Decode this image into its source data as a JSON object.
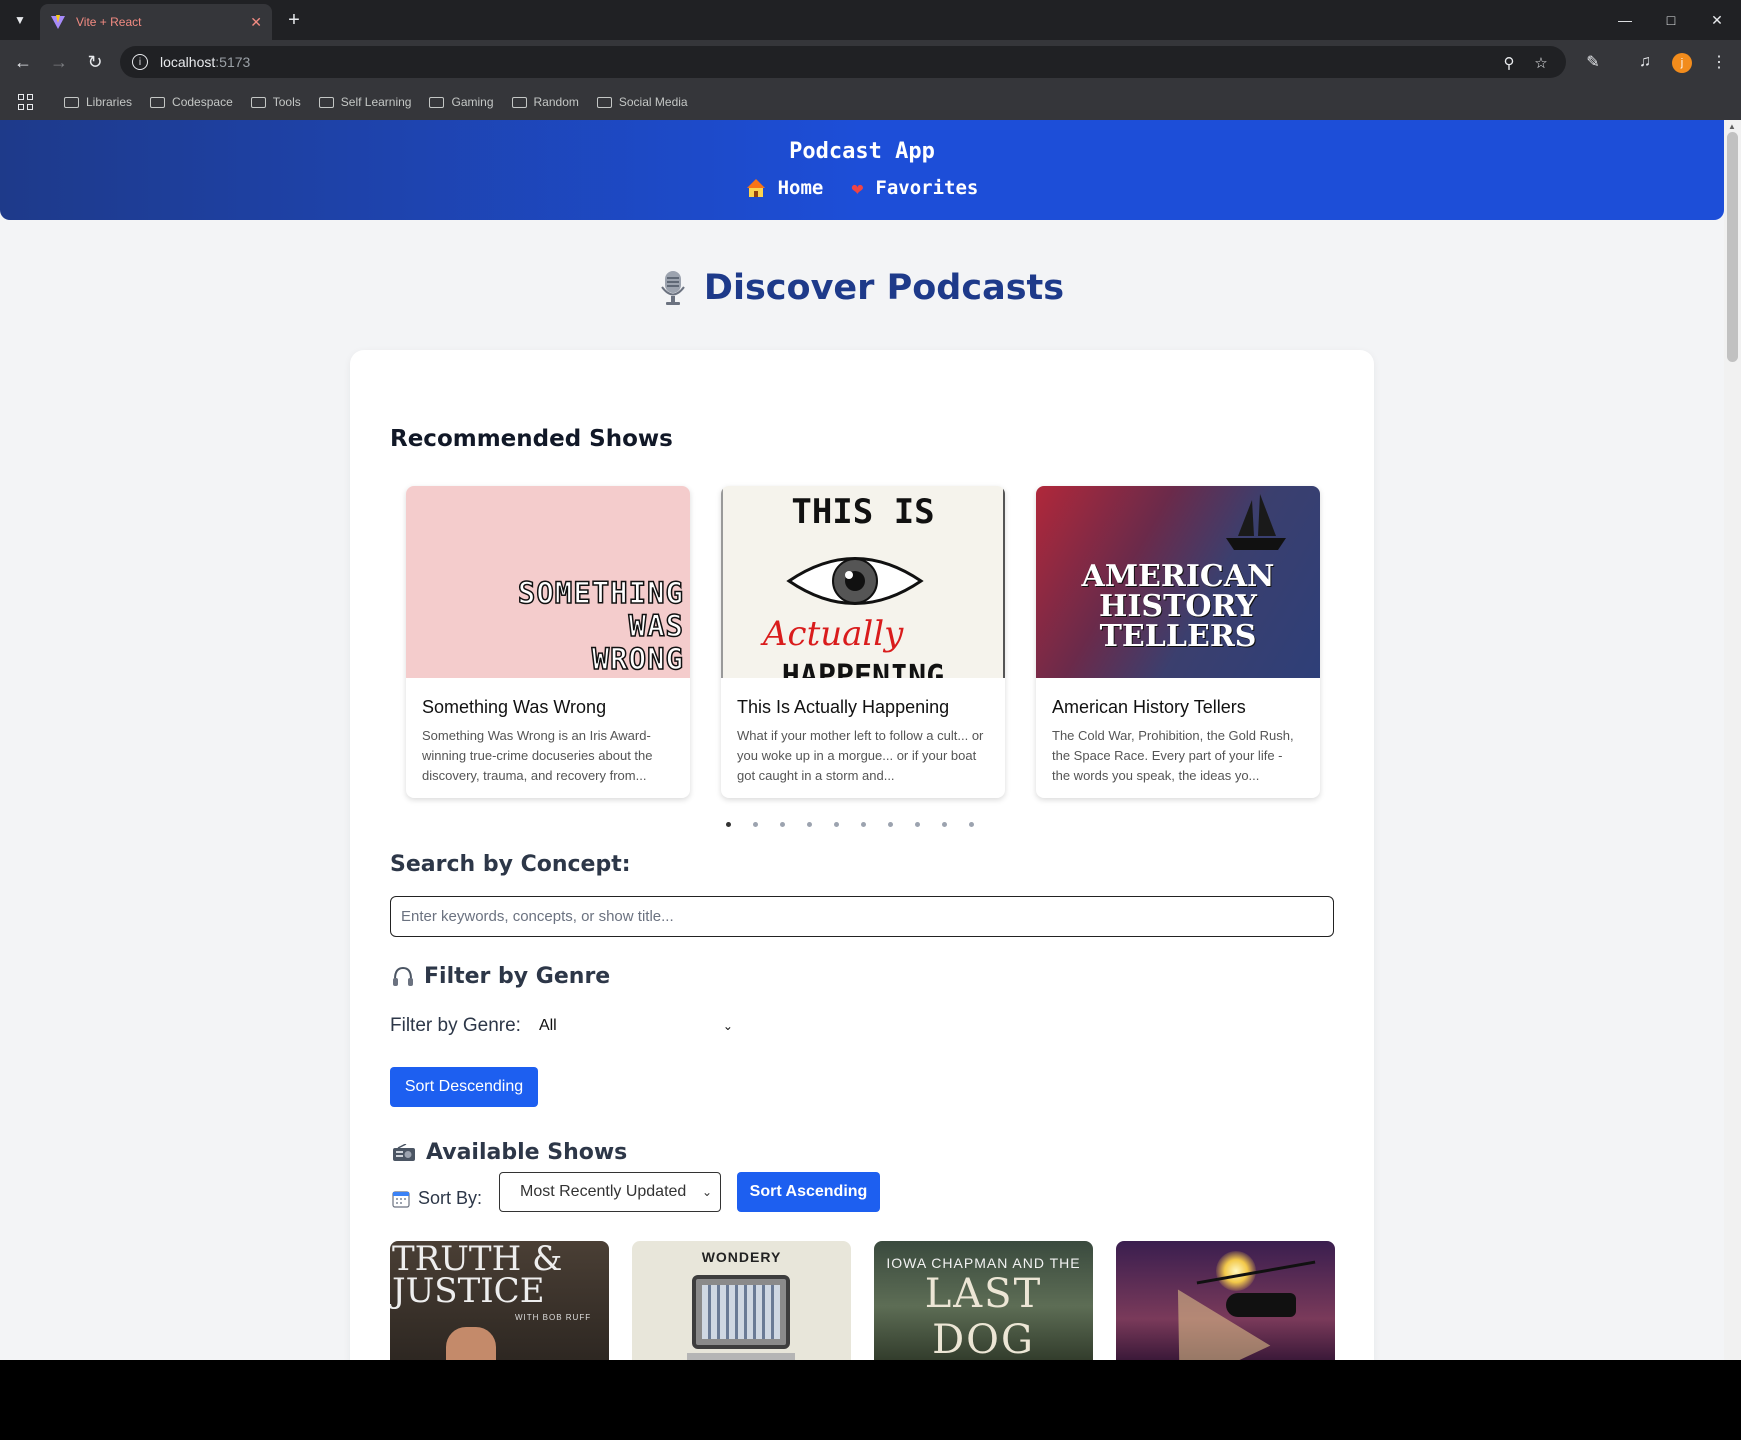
{
  "browser": {
    "tab_title": "Vite + React",
    "tab_close": "✕",
    "new_tab": "+",
    "url_host": "localhost",
    "url_port": ":5173",
    "bookmarks": [
      "Libraries",
      "Codespace",
      "Tools",
      "Self Learning",
      "Gaming",
      "Random",
      "Social Media"
    ],
    "avatar_letter": "j",
    "accent_color": "#f28b82"
  },
  "header": {
    "app_title": "Podcast App",
    "nav": [
      {
        "label": "Home",
        "icon": "house-icon"
      },
      {
        "label": "Favorites",
        "icon": "heart-icon"
      }
    ],
    "color": "#1d4ed8"
  },
  "page": {
    "title": "Discover Podcasts",
    "title_icon": "microphone-icon"
  },
  "recommended": {
    "heading": "Recommended Shows",
    "cards": [
      {
        "title": "Something Was Wrong",
        "description": "Something Was Wrong is an Iris Award-winning true-crime docuseries about the discovery, trauma, and recovery from...",
        "art_lines": [
          "SOMETHING",
          "WAS",
          "WRONG"
        ]
      },
      {
        "title": "This Is Actually Happening",
        "description": "What if your mother left to follow a cult... or you woke up in a morgue... or if your boat got caught in a storm and...",
        "art_top": "THIS IS",
        "art_mid": "Actually",
        "art_bottom": "HAPPENING"
      },
      {
        "title": "American History Tellers",
        "description": "The Cold War, Prohibition, the Gold Rush, the Space Race. Every part of your life - the words you speak, the ideas yo...",
        "art_lines": [
          "AMERICAN",
          "HISTORY",
          "TELLERS"
        ]
      }
    ],
    "dot_count": 10,
    "active_dot": 0
  },
  "search": {
    "label": "Search by Concept:",
    "placeholder": "Enter keywords, concepts, or show title...",
    "value": ""
  },
  "genre": {
    "heading": "Filter by Genre",
    "heading_icon": "headphones-icon",
    "label": "Filter by Genre:",
    "selected": "All",
    "sort_button": "Sort Descending"
  },
  "available": {
    "heading": "Available Shows",
    "heading_icon": "radio-icon",
    "sort_label": "Sort By:",
    "sort_selected": "Most Recently Updated",
    "sort_button": "Sort Ascending",
    "shows": [
      {
        "art_text": "TRUTH & JUSTICE",
        "art_sub": "WITH BOB RUFF"
      },
      {
        "art_text": "WONDERY"
      },
      {
        "art_text_1": "IOWA CHAPMAN AND THE",
        "art_text_2": "LAST DOG"
      },
      {
        "art_text": ""
      }
    ]
  }
}
